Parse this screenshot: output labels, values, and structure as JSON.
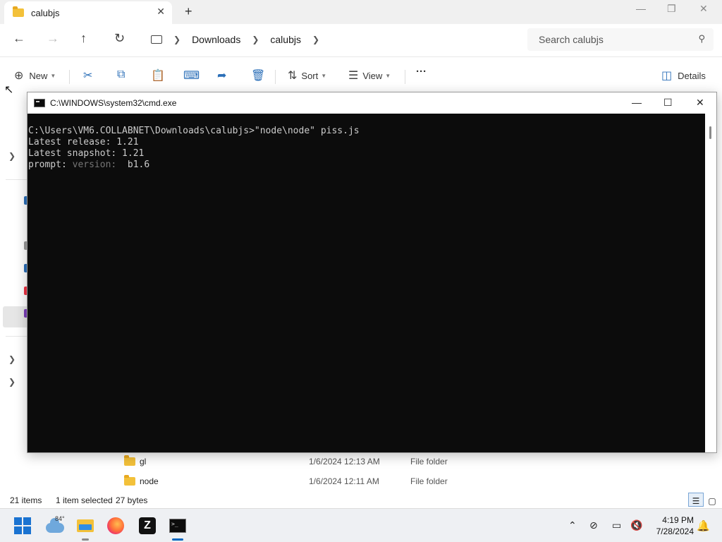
{
  "explorer": {
    "tab_title": "calubjs",
    "new_tab": "+",
    "tab_close": "✕",
    "breadcrumb": [
      "Downloads",
      "calubjs"
    ],
    "search_placeholder": "Search calubjs",
    "commands": {
      "new_label": "New",
      "sort_label": "Sort",
      "view_label": "View",
      "more_label": "···",
      "details_label": "Details"
    },
    "files": [
      {
        "name": "gl",
        "date": "1/6/2024 12:13 AM",
        "type": "File folder"
      },
      {
        "name": "node",
        "date": "1/6/2024 12:11 AM",
        "type": "File folder"
      }
    ],
    "status": {
      "items": "21 items",
      "selected": "1 item selected",
      "size": "27 bytes"
    }
  },
  "cmd": {
    "title": "C:\\WINDOWS\\system32\\cmd.exe",
    "lines": [
      "C:\\Users\\VM6.COLLABNET\\Downloads\\calubjs>\"node\\node\" piss.js",
      "Latest release: 1.21",
      "Latest snapshot: 1.21"
    ],
    "prompt_label": "prompt: ",
    "prompt_hint": "version:",
    "prompt_value": "  b1.6"
  },
  "taskbar": {
    "weather_temp": "84°",
    "time": "4:19 PM",
    "date": "7/28/2024"
  },
  "icons": {
    "back": "back-arrow-icon",
    "forward": "forward-arrow-icon",
    "up": "up-arrow-icon",
    "refresh": "refresh-icon"
  },
  "colors": {
    "accent": "#0067c0",
    "console_bg": "#0c0c0c",
    "console_fg": "#cccccc"
  }
}
